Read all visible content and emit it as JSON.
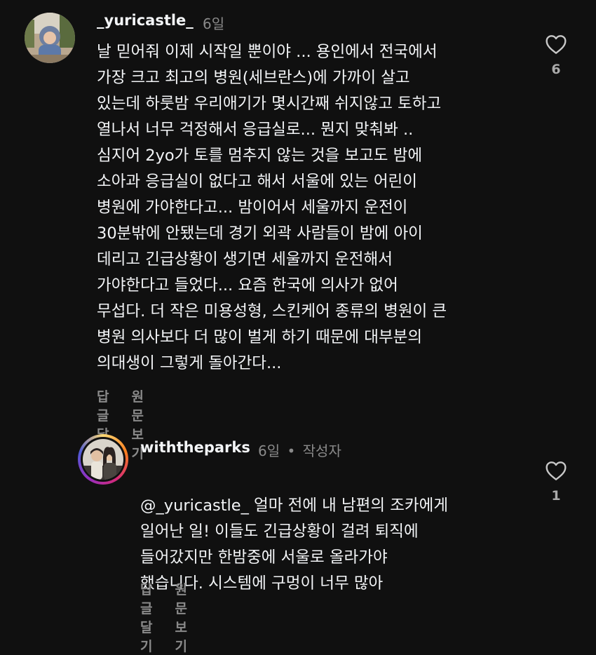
{
  "comment1": {
    "username": "_yuricastle_",
    "time": "6일",
    "text": "날 믿어줘 이제 시작일 뿐이야 ... 용인에서 전국에서\n가장 크고 최고의 병원(세브란스)에 가까이 살고\n있는데 하룻밤 우리애기가 몇시간째 쉬지않고 토하고\n열나서 너무 걱정해서 응급실로... 뭔지 맞춰봐 ..\n심지어 2yo가 토를 멈추지 않는 것을 보고도 밤에\n소아과 응급실이 없다고 해서 서울에 있는 어린이\n병원에 가야한다고... 밤이어서 세울까지 운전이\n30분밖에 안됐는데 경기 외곽 사람들이 밤에 아이\n데리고 긴급상황이 생기면 세울까지 운전해서\n가야한다고 들었다... 요즘 한국에 의사가 없어\n무섭다. 더 작은 미용성형, 스킨케어 종류의 병원이 큰\n병원 의사보다 더 많이 벌게 하기 때문에 대부분의\n의대생이 그렇게 돌아간다...",
    "reply_label": "답글 달기",
    "translate_label": "원문 보기",
    "like_count": "6"
  },
  "comment2": {
    "username": "withtheparks",
    "time": "6일",
    "separator": "•",
    "author_badge": "작성자",
    "mention": "@_yuricastle_",
    "text": " 얼마 전에 내 남편의 조카에게\n일어난 일! 이들도 긴급상황이 걸려 퇴직에\n들어갔지만 한밤중에 서울로 올라가야\n했습니다. 시스템에 구멍이 너무 많아",
    "reply_label": "답글 달기",
    "translate_label": "원문 보기",
    "like_count": "1"
  },
  "icons": {
    "like": "heart-outline-icon",
    "avatar1": "child-photo-avatar",
    "avatar2": "couple-photo-avatar"
  },
  "colors": {
    "background": "#101010",
    "text": "#f3f5f7",
    "muted": "#8a8a8a",
    "story_ring": "#e1306c"
  }
}
